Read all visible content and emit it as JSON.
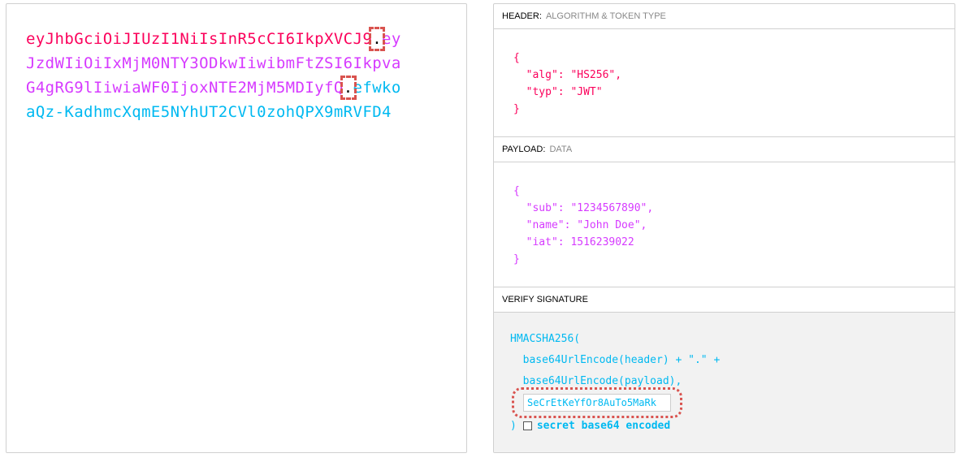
{
  "encoded": {
    "lines": [
      {
        "header": "eyJhbGciOiJIUzI1NiIsInR5cCI6IkpXVCJ9",
        "dot": ".",
        "payload": "ey"
      },
      {
        "payload": "JzdWIiOiIxMjM0NTY3ODkwIiwibmFtZSI6Ikpva"
      },
      {
        "payload": "G4gRG9lIiwiaWF0IjoxNTE2MjM5MDIyfQ",
        "dot": ".",
        "signature": "efwko"
      },
      {
        "signature": "aQz-KadhmcXqmE5NYhUT2CVl0zohQPX9mRVFD4"
      }
    ]
  },
  "decoded": {
    "header_section": {
      "title": "HEADER:",
      "subtitle": "ALGORITHM & TOKEN TYPE",
      "lines": [
        "{",
        "  \"alg\": \"HS256\",",
        "  \"typ\": \"JWT\"",
        "}"
      ]
    },
    "payload_section": {
      "title": "PAYLOAD:",
      "subtitle": "DATA",
      "lines": [
        "{",
        "  \"sub\": \"1234567890\",",
        "  \"name\": \"John Doe\",",
        "  \"iat\": 1516239022",
        "}"
      ]
    },
    "verify_section": {
      "title": "VERIFY SIGNATURE",
      "lines": [
        "HMACSHA256(",
        "  base64UrlEncode(header) + \".\" +",
        "  base64UrlEncode(payload),"
      ],
      "secret_value": "SeCrEtKeYfOr8AuTo5MaRk",
      "close_paren": ")",
      "checkbox_label": "secret base64 encoded"
    }
  },
  "colors": {
    "header": "#fb015b",
    "payload": "#d63aff",
    "signature": "#00b9f1",
    "highlight": "#d9534f"
  }
}
